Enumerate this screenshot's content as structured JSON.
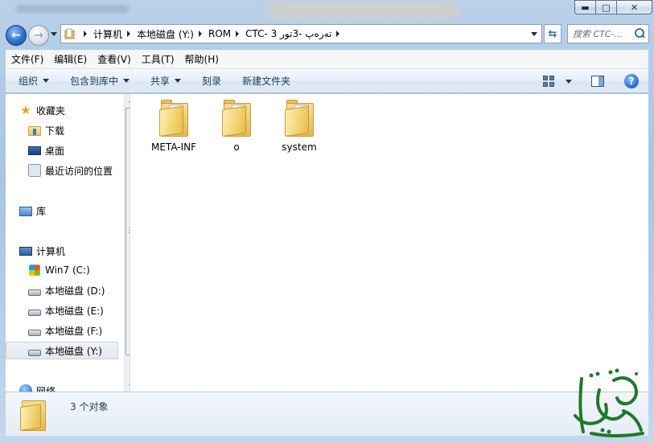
{
  "window": {
    "min_glyph": "▬",
    "max_glyph": "□",
    "close_glyph": "✕"
  },
  "address": {
    "breadcrumbs": [
      "计算机",
      "本地磁盘 (Y:)",
      "ROM",
      "CTC- تەرەپ -3تور 3"
    ],
    "search_placeholder": "搜索 CTC-..."
  },
  "menu": [
    "文件(F)",
    "编辑(E)",
    "查看(V)",
    "工具(T)",
    "帮助(H)"
  ],
  "commands": {
    "organize": "组织",
    "include_in_library": "包含到库中",
    "share": "共享",
    "burn": "刻录",
    "new_folder": "新建文件夹"
  },
  "nav": {
    "favorites": "收藏夹",
    "downloads": "下载",
    "desktop": "桌面",
    "recent": "最近访问的位置",
    "libraries": "库",
    "computer": "计算机",
    "drive_c": "Win7 (C:)",
    "drive_d": "本地磁盘 (D:)",
    "drive_e": "本地磁盘 (E:)",
    "drive_f": "本地磁盘 (F:)",
    "drive_y": "本地磁盘 (Y:)",
    "network": "网络"
  },
  "files": [
    {
      "name": "META-INF",
      "type": "folder"
    },
    {
      "name": "o",
      "type": "folder"
    },
    {
      "name": "system",
      "type": "folder"
    }
  ],
  "details": {
    "item_count": "3 个对象"
  },
  "colors": {
    "accent": "#1e395b",
    "watermark": "#1f7a2a",
    "selection": "#e4e8ee"
  }
}
